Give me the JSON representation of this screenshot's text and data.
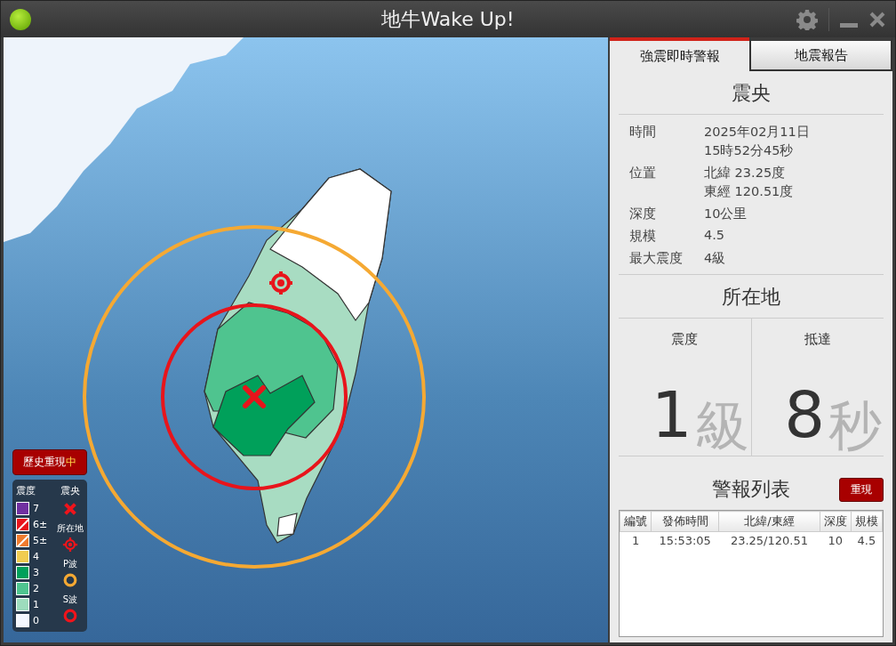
{
  "window": {
    "title": "地牛Wake Up!"
  },
  "map": {
    "replay_badge": {
      "label": "歷史重現",
      "suffix": "中"
    },
    "legend": {
      "intensity_title": "震度",
      "symbols_title": "震央",
      "levels": [
        {
          "label": "7",
          "color": "#7030a0",
          "kind": "solid"
        },
        {
          "label": "6±",
          "color": "#e8141b",
          "kind": "split"
        },
        {
          "label": "5±",
          "color": "#f07b2e",
          "kind": "split"
        },
        {
          "label": "4",
          "color": "#f0cc50",
          "kind": "solid"
        },
        {
          "label": "3",
          "color": "#00a05a",
          "kind": "solid"
        },
        {
          "label": "2",
          "color": "#4fc48f",
          "kind": "solid"
        },
        {
          "label": "1",
          "color": "#9ddcbd",
          "kind": "solid"
        },
        {
          "label": "0",
          "color": "#f4f8ff",
          "kind": "solid"
        }
      ],
      "symbols": [
        {
          "label": "所在地",
          "kind": "location"
        },
        {
          "label": "P波",
          "kind": "p_wave"
        },
        {
          "label": "S波",
          "kind": "s_wave"
        }
      ]
    }
  },
  "tabs": [
    {
      "label": "強震即時警報",
      "selected": true
    },
    {
      "label": "地震報告",
      "selected": false
    }
  ],
  "epicenter": {
    "title": "震央",
    "fields": [
      {
        "label": "時間",
        "lines": [
          "2025年02月11日",
          "15時52分45秒"
        ]
      },
      {
        "label": "位置",
        "lines": [
          "北緯 23.25度",
          "東經 120.51度"
        ]
      },
      {
        "label": "深度",
        "lines": [
          "10公里"
        ]
      },
      {
        "label": "規模",
        "lines": [
          "4.5"
        ]
      },
      {
        "label": "最大震度",
        "lines": [
          "4級"
        ]
      }
    ]
  },
  "location": {
    "title": "所在地",
    "cells": [
      {
        "label": "震度",
        "value": "1",
        "unit": "級"
      },
      {
        "label": "抵達",
        "value": "8",
        "unit": "秒"
      }
    ]
  },
  "alerts": {
    "title": "警報列表",
    "replay_button": "重現",
    "columns": [
      "編號",
      "發佈時間",
      "北緯/東經",
      "深度",
      "規模"
    ],
    "rows": [
      [
        "1",
        "15:53:05",
        "23.25/120.51",
        "10",
        "4.5"
      ]
    ]
  }
}
